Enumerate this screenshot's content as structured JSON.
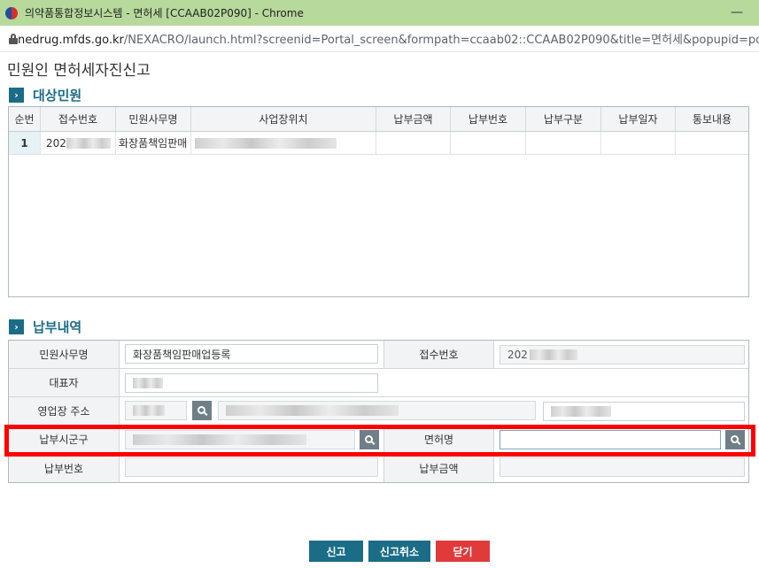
{
  "window": {
    "title": "의약품통합정보시스템 - 면허세 [CCAAB02P090] - Chrome",
    "minimize_glyph": "—",
    "url_host": "nedrug.mfds.go.kr",
    "url_path": "/NEXACRO/launch.html?screenid=Portal_screen&formpath=ccaab02::CCAAB02P090&title=면허세&popupid=pop"
  },
  "page": {
    "title": "민원인 면허세자진신고"
  },
  "sections": {
    "target": {
      "badge": "›",
      "title": "대상민원"
    },
    "payment": {
      "badge": "›",
      "title": "납부내역"
    }
  },
  "grid": {
    "columns": [
      "순번",
      "접수번호",
      "민원사무명",
      "사업장위치",
      "납부금액",
      "납부번호",
      "납부구분",
      "납부일자",
      "통보내용"
    ],
    "rows": [
      {
        "no": "1",
        "receipt_no": "202",
        "service_name": "화장품책임판매",
        "location": "",
        "amount": "",
        "pay_no": "",
        "pay_type": "",
        "pay_date": "",
        "notice": ""
      }
    ]
  },
  "form": {
    "service_name": {
      "label": "민원사무명",
      "value": "화장품책임판매업등록"
    },
    "receipt_no": {
      "label": "접수번호",
      "value": "202"
    },
    "representative": {
      "label": "대표자",
      "value": ""
    },
    "business_address": {
      "label": "영업장 주소",
      "value": ""
    },
    "pay_district": {
      "label": "납부시군구",
      "value": ""
    },
    "license_name": {
      "label": "면허명",
      "value": ""
    },
    "pay_no": {
      "label": "납부번호",
      "value": ""
    },
    "pay_amount": {
      "label": "납부금액",
      "value": ""
    }
  },
  "buttons": {
    "report": {
      "label": "신고",
      "color": "#1b6c87"
    },
    "cancel_report": {
      "label": "신고취소",
      "color": "#1b6c87"
    },
    "close": {
      "label": "닫기",
      "color": "#e03a3a"
    }
  },
  "colors": {
    "accent": "#1b6c87",
    "titlebar": "#b7d99b",
    "highlight": "#ff0000"
  }
}
